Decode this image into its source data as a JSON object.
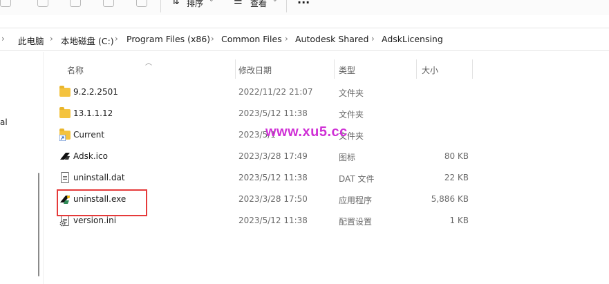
{
  "toolbar": {
    "sort_label": "排序",
    "view_label": "查看",
    "more_label": "···"
  },
  "breadcrumb": [
    "此电脑",
    "本地磁盘 (C:)",
    "Program Files (x86)",
    "Common Files",
    "Autodesk Shared",
    "AdskLicensing"
  ],
  "sidebar": {
    "partial_text": "al"
  },
  "columns": {
    "name": "名称",
    "date": "修改日期",
    "type": "类型",
    "size": "大小"
  },
  "files": [
    {
      "name": "9.2.2.2501",
      "date": "2022/11/22 21:07",
      "type": "文件夹",
      "size": "",
      "icon": "folder-icon"
    },
    {
      "name": "13.1.1.12",
      "date": "2023/5/12 11:38",
      "type": "文件夹",
      "size": "",
      "icon": "folder-icon"
    },
    {
      "name": "Current",
      "date": "2023/5/1",
      "type": "文件夹",
      "size": "",
      "icon": "folder-shortcut-icon"
    },
    {
      "name": "Adsk.ico",
      "date": "2023/3/28 17:49",
      "type": "图标",
      "size": "80 KB",
      "icon": "autodesk-icon"
    },
    {
      "name": "uninstall.dat",
      "date": "2023/5/12 11:38",
      "type": "DAT 文件",
      "size": "22 KB",
      "icon": "document-icon"
    },
    {
      "name": "uninstall.exe",
      "date": "2023/3/28 17:50",
      "type": "应用程序",
      "size": "5,886 KB",
      "icon": "autodesk-app-icon"
    },
    {
      "name": "version.ini",
      "date": "2023/5/12 11:38",
      "type": "配置设置",
      "size": "1 KB",
      "icon": "settings-file-icon"
    }
  ],
  "watermark": "www.xu5.cc",
  "colors": {
    "folder": "#f4c33f",
    "highlight": "#e53a3a",
    "watermark": "#cf2fd5"
  }
}
